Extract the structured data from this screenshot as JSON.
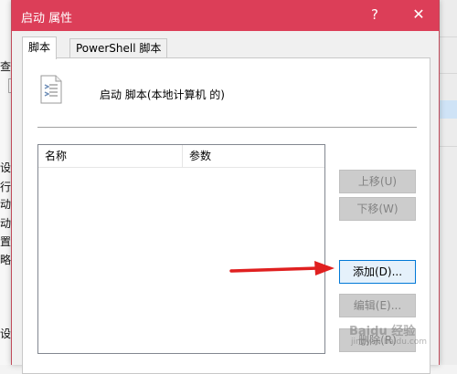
{
  "background": {
    "left_fragments": [
      "查看",
      "设置",
      "行策",
      "动/关",
      "动打",
      "置",
      "略的",
      "设置"
    ],
    "right_panel_color": "#cfe3f6"
  },
  "dialog": {
    "title": "启动 属性",
    "help_glyph": "?",
    "close_glyph": "✕",
    "titlebar_color": "#dc3e58",
    "tabs": [
      {
        "label": "脚本",
        "active": true
      },
      {
        "label": "PowerShell 脚本",
        "active": false
      }
    ],
    "heading": "启动 脚本(本地计算机 的)",
    "icon": "script-file-icon",
    "list": {
      "columns": [
        "名称",
        "参数"
      ],
      "rows": []
    },
    "buttons": {
      "move_up": "上移(U)",
      "move_down": "下移(W)",
      "add": "添加(D)...",
      "edit": "编辑(E)...",
      "delete": "删除(R)"
    }
  },
  "annotation": {
    "arrow_color": "#e02020",
    "points_to": "add"
  },
  "watermark": {
    "text": "Baidu 经验",
    "sub": "jingyan.baidu.com"
  }
}
